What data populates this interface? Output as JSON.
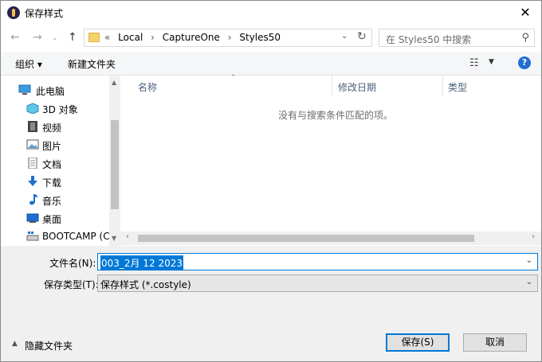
{
  "window": {
    "title": "保存样式",
    "close_symbol": "✕"
  },
  "nav": {
    "breadcrumb_prefix": "«",
    "breadcrumbs": [
      "Local",
      "CaptureOne",
      "Styles50"
    ],
    "search_placeholder": "在 Styles50 中搜索"
  },
  "toolbar": {
    "organize": "组织 ▾",
    "new_folder": "新建文件夹"
  },
  "sidebar": {
    "items": [
      {
        "label": "此电脑",
        "icon": "computer-icon"
      },
      {
        "label": "3D 对象",
        "icon": "cube-icon"
      },
      {
        "label": "视频",
        "icon": "film-icon"
      },
      {
        "label": "图片",
        "icon": "picture-icon"
      },
      {
        "label": "文档",
        "icon": "document-icon"
      },
      {
        "label": "下载",
        "icon": "download-arrow-icon"
      },
      {
        "label": "音乐",
        "icon": "music-note-icon"
      },
      {
        "label": "桌面",
        "icon": "desktop-icon"
      },
      {
        "label": "BOOTCAMP (C",
        "icon": "drive-icon"
      }
    ]
  },
  "filelist": {
    "columns": [
      "名称",
      "修改日期",
      "类型"
    ],
    "empty_message": "没有与搜索条件匹配的项。"
  },
  "form": {
    "filename_label": "文件名(N):",
    "filename_value": "003_2月 12 2023",
    "filetype_label": "保存类型(T):",
    "filetype_value": "保存样式 (*.costyle)"
  },
  "footer": {
    "hide_folders": "隐藏文件夹",
    "save_button": "保存(S)",
    "cancel_button": "取消"
  },
  "colors": {
    "accent": "#0078d7",
    "help": "#1e6fd1"
  }
}
